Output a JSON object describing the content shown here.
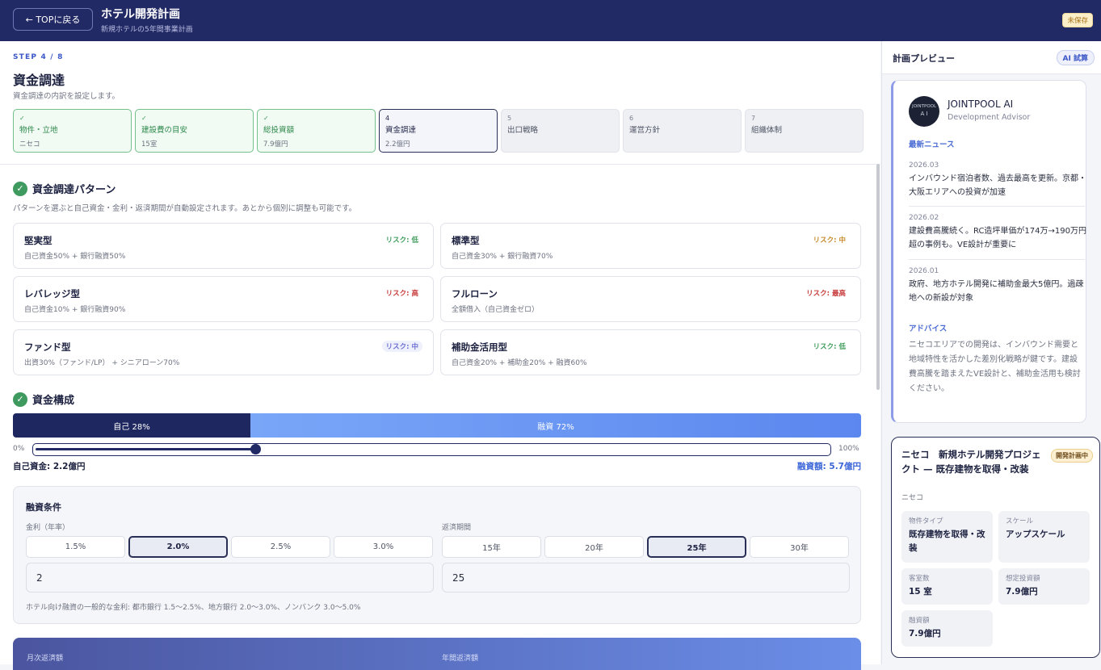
{
  "header": {
    "back_label": "← TOPに戻る",
    "title": "ホテル開発計画",
    "subtitle": "新規ホテルの5年間事業計画",
    "unsaved_badge": "未保存"
  },
  "wizard": {
    "step_indicator": "STEP 4 / 8",
    "title": "資金調達",
    "description": "資金調達の内訳を設定します。",
    "steps": [
      {
        "num": "✓",
        "name": "物件・立地",
        "value": "ニセコ",
        "state": "done"
      },
      {
        "num": "✓",
        "name": "建設費の目安",
        "value": "15室",
        "state": "done"
      },
      {
        "num": "✓",
        "name": "総投資額",
        "value": "7.9億円",
        "state": "done"
      },
      {
        "num": "4",
        "name": "資金調達",
        "value": "2.2億円",
        "state": "active"
      },
      {
        "num": "5",
        "name": "出口戦略",
        "value": "",
        "state": "todo"
      },
      {
        "num": "6",
        "name": "運営方針",
        "value": "",
        "state": "todo"
      },
      {
        "num": "7",
        "name": "組織体制",
        "value": "",
        "state": "todo"
      }
    ]
  },
  "patterns": {
    "heading": "資金調達パターン",
    "note": "パターンを選ぶと自己資金・金利・返済期間が自動設定されます。あとから個別に調整も可能です。",
    "items": [
      {
        "title": "堅実型",
        "desc": "自己資金50% + 銀行融資50%",
        "risk": "リスク: 低",
        "risk_level": "low"
      },
      {
        "title": "標準型",
        "desc": "自己資金30% + 銀行融資70%",
        "risk": "リスク: 中",
        "risk_level": "mid"
      },
      {
        "title": "レバレッジ型",
        "desc": "自己資金10% + 銀行融資90%",
        "risk": "リスク: 高",
        "risk_level": "high"
      },
      {
        "title": "フルローン",
        "desc": "全額借入（自己資金ゼロ）",
        "risk": "リスク: 最高",
        "risk_level": "high"
      },
      {
        "title": "ファンド型",
        "desc": "出資30%（ファンド/LP） + シニアローン70%",
        "risk": "リスク: 中",
        "risk_level": "fund"
      },
      {
        "title": "補助金活用型",
        "desc": "自己資金20% + 補助金20% + 融資60%",
        "risk": "リスク: 低",
        "risk_level": "low"
      }
    ]
  },
  "structure": {
    "heading": "資金構成",
    "own_ratio": 0.28,
    "own_label": "自己 28%",
    "loan_label": "融資 72%",
    "min_label": "0%",
    "max_label": "100%",
    "own_amount": "自己資金: 2.2億円",
    "loan_amount": "融資額: 5.7億円"
  },
  "conditions": {
    "heading": "融資条件",
    "rate_label": "金利（年率）",
    "rate_options": [
      "1.5%",
      "2.0%",
      "2.5%",
      "3.0%"
    ],
    "rate_selected": "2.0%",
    "rate_value": "2",
    "term_label": "返済期間",
    "term_options": [
      "15年",
      "20年",
      "25年",
      "30年"
    ],
    "term_selected": "25年",
    "term_value": "25",
    "hint": "ホテル向け融資の一般的な金利: 都市銀行 1.5〜2.5%、地方銀行 2.0〜3.0%、ノンバンク 3.0〜5.0%"
  },
  "payment": {
    "monthly_label": "月次返済額",
    "annual_label": "年間返済額"
  },
  "sidebar": {
    "title": "計画プレビュー",
    "ai_badge": "AI 試算",
    "advisor": {
      "logo_line1": "JOINTPOOL",
      "logo_line2": "A I",
      "name": "JOINTPOOL AI",
      "role": "Development Advisor",
      "news_heading": "最新ニュース",
      "news": [
        {
          "date": "2026.03",
          "text": "インバウンド宿泊者数、過去最高を更新。京都・大阪エリアへの投資が加速"
        },
        {
          "date": "2026.02",
          "text": "建設費高騰続く。RC造坪単価が174万→190万円超の事例も。VE設計が重要に"
        },
        {
          "date": "2026.01",
          "text": "政府、地方ホテル開発に補助金最大5億円。過疎地への新設が対象"
        }
      ],
      "advice_heading": "アドバイス",
      "advice": "ニセコエリアでの開発は、インバウンド需要と地域特性を活かした差別化戦略が鍵です。建設費高騰を踏まえたVE設計と、補助金活用も検討ください。"
    },
    "project": {
      "title": "ニセコ　新規ホテル開発プロジェクト — 既存建物を取得・改装",
      "badge": "開発計画中",
      "location": "ニセコ",
      "cells": [
        {
          "k": "物件タイプ",
          "v": "既存建物を取得・改装"
        },
        {
          "k": "スケール",
          "v": "アップスケール"
        },
        {
          "k": "客室数",
          "v": "15 室"
        },
        {
          "k": "想定投資額",
          "v": "7.9億円"
        },
        {
          "k": "融資額",
          "v": "7.9億円"
        }
      ]
    }
  }
}
